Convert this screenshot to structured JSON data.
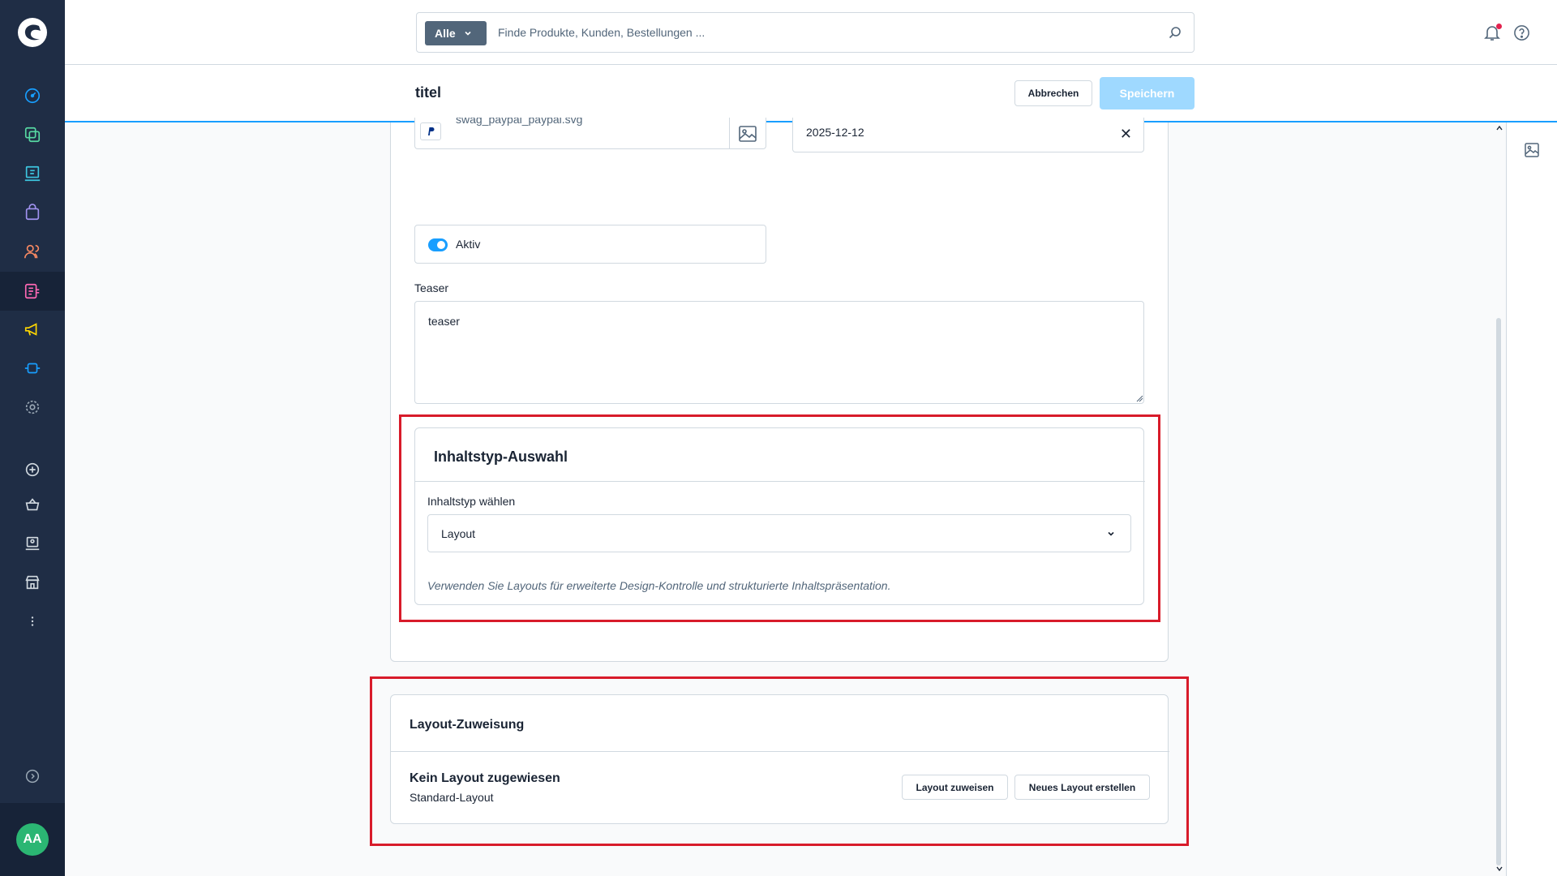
{
  "search": {
    "type_label": "Alle",
    "placeholder": "Finde Produkte, Kunden, Bestellungen ..."
  },
  "smartbar": {
    "title": "titel",
    "cancel_label": "Abbrechen",
    "save_label": "Speichern"
  },
  "form": {
    "file_name": "swag_paypal_paypal.svg",
    "date_value": "2025-12-12",
    "active_label": "Aktiv",
    "active": true,
    "teaser_label": "Teaser",
    "teaser_value": "teaser"
  },
  "content_type": {
    "title": "Inhaltstyp-Auswahl",
    "select_label": "Inhaltstyp wählen",
    "selected_value": "Layout",
    "help_text": "Verwenden Sie Layouts für erweiterte Design-Kontrolle und strukturierte Inhaltspräsentation."
  },
  "layout_assignment": {
    "title": "Layout-Zuweisung",
    "none_label": "Kein Layout zugewiesen",
    "default_label": "Standard-Layout",
    "assign_label": "Layout zuweisen",
    "new_label": "Neues Layout erstellen"
  },
  "user": {
    "initials": "AA"
  },
  "colors": {
    "sidebar": "#1f2d45",
    "accent": "#189eff",
    "highlight": "#d81b2a",
    "avatar": "#2bb673"
  },
  "sidebar_icons": [
    "dashboard-icon",
    "catalogue-icon",
    "orders-icon",
    "shopping-bag-icon",
    "customers-icon",
    "content-icon",
    "marketing-icon",
    "extensions-icon",
    "settings-icon",
    "add-circle-icon",
    "basket-icon",
    "storefront-icon",
    "shop-icon",
    "more-icon",
    "expand-icon"
  ]
}
